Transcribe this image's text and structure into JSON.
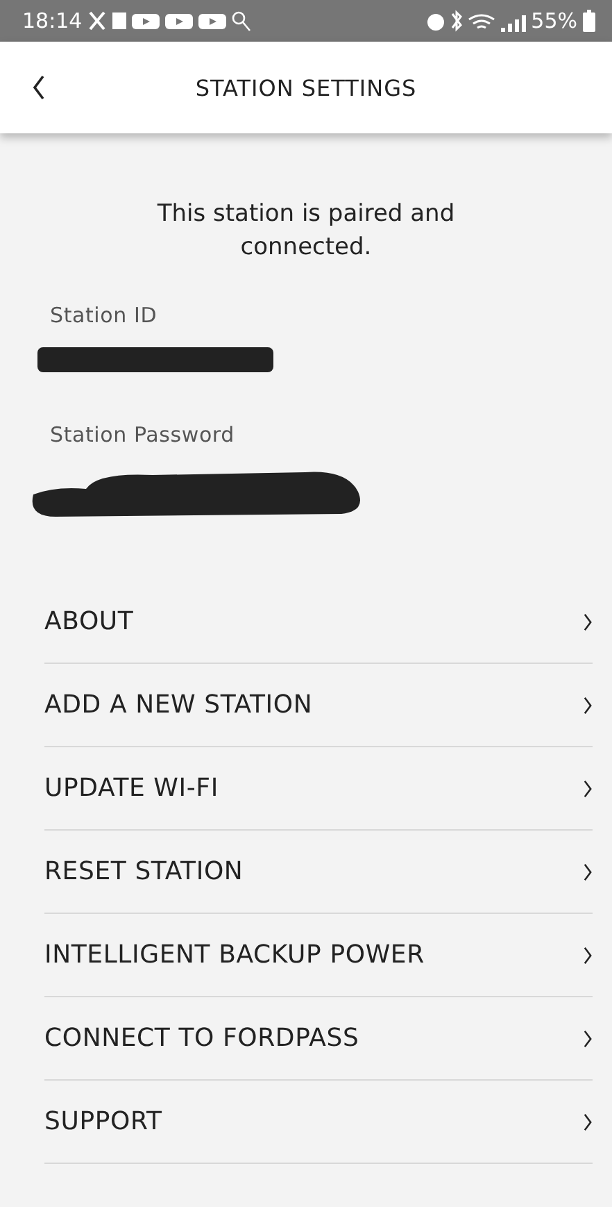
{
  "status_bar": {
    "time": "18:14",
    "battery": "55%"
  },
  "header": {
    "title": "STATION SETTINGS"
  },
  "status_message": "This station is paired and connected.",
  "fields": [
    {
      "label": "Station ID",
      "kind": "redacted"
    },
    {
      "label": "Station Password",
      "kind": "redacted"
    }
  ],
  "menu": [
    {
      "label": "ABOUT"
    },
    {
      "label": "ADD A NEW STATION"
    },
    {
      "label": "UPDATE WI-FI"
    },
    {
      "label": "RESET STATION"
    },
    {
      "label": "INTELLIGENT BACKUP POWER"
    },
    {
      "label": "CONNECT TO FORDPASS"
    },
    {
      "label": "SUPPORT"
    }
  ]
}
